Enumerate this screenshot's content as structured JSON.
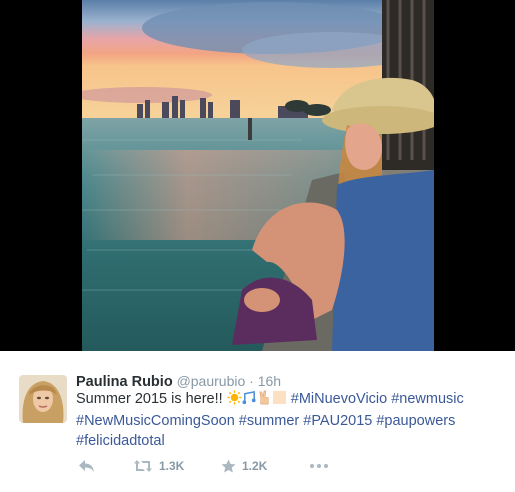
{
  "tweet": {
    "author_name": "Paulina Rubio",
    "author_handle": "@paurubio",
    "separator": "·",
    "time": "16h",
    "text_lead": "Summer 2015 is here!!",
    "hashtags": [
      "#MiNuevoVicio",
      "#newmusic",
      "#NewMusicComingSoon",
      "#summer",
      "#PAU2015",
      "#paupowers",
      "#felicidadtotal"
    ],
    "emojis": [
      "sun-emoji",
      "music-notes-emoji",
      "peace-hand-emoji",
      "skin-tone-block-emoji"
    ],
    "retweet_count": "1.3K",
    "favorite_count": "1.2K"
  },
  "colors": {
    "hashtag": "#3b5998",
    "text": "#292f33",
    "muted": "#8899a6",
    "icon": "#aab8c2"
  }
}
